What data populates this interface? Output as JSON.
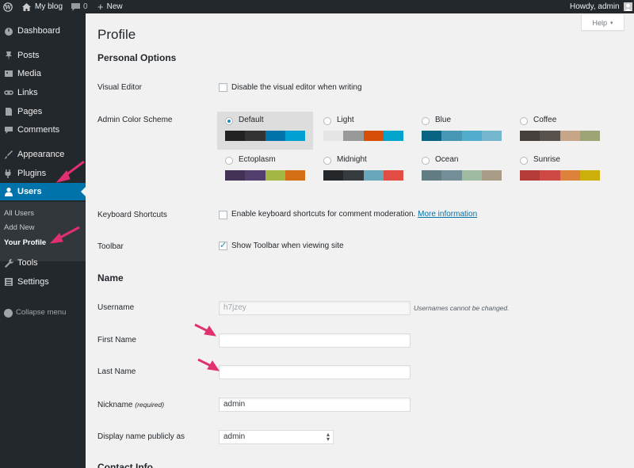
{
  "admin_bar": {
    "site_name": "My blog",
    "comments_count": "0",
    "new_label": "New",
    "howdy": "Howdy, admin"
  },
  "sidebar": {
    "items": [
      {
        "label": "Dashboard",
        "icon": "dashboard-icon"
      },
      {
        "label": "Posts",
        "icon": "pin-icon"
      },
      {
        "label": "Media",
        "icon": "media-icon"
      },
      {
        "label": "Links",
        "icon": "link-icon"
      },
      {
        "label": "Pages",
        "icon": "page-icon"
      },
      {
        "label": "Comments",
        "icon": "comment-icon"
      },
      {
        "label": "Appearance",
        "icon": "paintbrush-icon"
      },
      {
        "label": "Plugins",
        "icon": "plugin-icon"
      },
      {
        "label": "Users",
        "icon": "user-icon"
      },
      {
        "label": "Tools",
        "icon": "wrench-icon"
      },
      {
        "label": "Settings",
        "icon": "settings-icon"
      }
    ],
    "submenu": [
      "All Users",
      "Add New",
      "Your Profile"
    ],
    "collapse_label": "Collapse menu"
  },
  "colors": {
    "admin_bar_bg": "#23282d",
    "sidebar_bg": "#23282d",
    "submenu_bg": "#32373c",
    "accent": "#0073aa",
    "annotation_arrow": "#e0306f",
    "page_bg": "#f1f1f1"
  },
  "main": {
    "help_label": "Help",
    "page_title": "Profile",
    "personal_options_heading": "Personal Options",
    "visual_editor": {
      "label": "Visual Editor",
      "checkbox_label": "Disable the visual editor when writing",
      "checked": false
    },
    "color_scheme": {
      "label": "Admin Color Scheme",
      "selected": "Default",
      "schemes": [
        {
          "name": "Default",
          "colors": [
            "#222222",
            "#333333",
            "#0073aa",
            "#00a0d2"
          ]
        },
        {
          "name": "Light",
          "colors": [
            "#e5e5e5",
            "#999999",
            "#d64e07",
            "#04a4cc"
          ]
        },
        {
          "name": "Blue",
          "colors": [
            "#096484",
            "#4796b3",
            "#52accc",
            "#74b6ce"
          ]
        },
        {
          "name": "Coffee",
          "colors": [
            "#46403c",
            "#59524c",
            "#c7a589",
            "#9ea476"
          ]
        },
        {
          "name": "Ectoplasm",
          "colors": [
            "#413256",
            "#523f6d",
            "#a3b745",
            "#d46f15"
          ]
        },
        {
          "name": "Midnight",
          "colors": [
            "#25282b",
            "#363b3f",
            "#69a8bb",
            "#e14d43"
          ]
        },
        {
          "name": "Ocean",
          "colors": [
            "#627c83",
            "#738e96",
            "#9ebaa0",
            "#aa9d88"
          ]
        },
        {
          "name": "Sunrise",
          "colors": [
            "#b43c38",
            "#cf4944",
            "#dd823b",
            "#ccaf0b"
          ]
        }
      ]
    },
    "keyboard_shortcuts": {
      "label": "Keyboard Shortcuts",
      "checkbox_label": "Enable keyboard shortcuts for comment moderation.",
      "link": "More information",
      "checked": false
    },
    "toolbar": {
      "label": "Toolbar",
      "checkbox_label": "Show Toolbar when viewing site",
      "checked": true
    },
    "name_heading": "Name",
    "username": {
      "label": "Username",
      "value": "h7jzey",
      "note": "Usernames cannot be changed."
    },
    "first_name": {
      "label": "First Name",
      "value": ""
    },
    "last_name": {
      "label": "Last Name",
      "value": ""
    },
    "nickname": {
      "label": "Nickname",
      "required": "(required)",
      "value": "admin"
    },
    "display_name": {
      "label": "Display name publicly as",
      "value": "admin"
    },
    "contact_heading": "Contact Info"
  }
}
